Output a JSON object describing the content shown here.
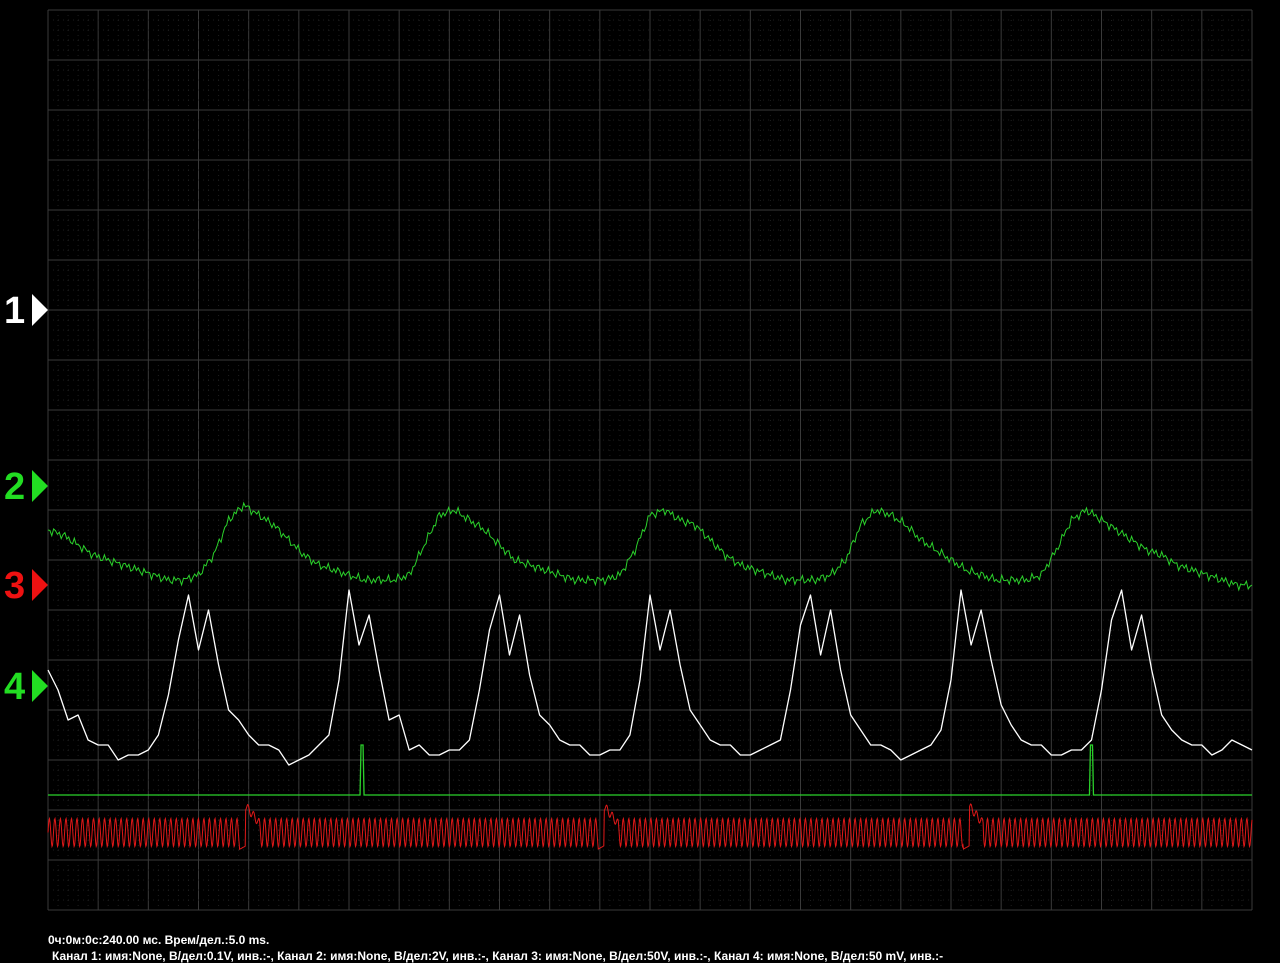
{
  "chart_data": {
    "type": "line",
    "title": "",
    "grid": true,
    "grid_divisions": {
      "horizontal": 24,
      "vertical": 18
    },
    "time_per_division_ms": 5.0,
    "x_unit": "ms",
    "x_range_ms": [
      0,
      120
    ],
    "colors": {
      "background": "#000000",
      "grid": "#3a3a3a",
      "white_trace": "#ffffff",
      "green_trace": "#2bd12b",
      "red_trace": "#e01818",
      "marker_green": "#22dd22",
      "marker_red": "#ee1111"
    },
    "channel_markers": [
      {
        "label": "1",
        "color": "#ffffff"
      },
      {
        "label": "2",
        "color": "#22dd22"
      },
      {
        "label": "3",
        "color": "#ee1111"
      },
      {
        "label": "4",
        "color": "#22dd22"
      }
    ],
    "series": [
      {
        "color": "#2bd12b",
        "x_ms": [
          0,
          1.5,
          3,
          4.5,
          6,
          7.5,
          9,
          10.5,
          12,
          13.5,
          15,
          16.5,
          18,
          19.5,
          21,
          22.5,
          24,
          25.5,
          27,
          28.5,
          30,
          31.5,
          33,
          34.5,
          36,
          37.5,
          39,
          40.5,
          42,
          43.5,
          45,
          46.5,
          48,
          49.5,
          51,
          52.5,
          54,
          55.5,
          57,
          58.5,
          60,
          61.5,
          63,
          64.5,
          66,
          67.5,
          69,
          70.5,
          72,
          73.5,
          75,
          76.5,
          78,
          79.5,
          81,
          82.5,
          84,
          85.5,
          87,
          88.5,
          90,
          91.5,
          93,
          94.5,
          96,
          97.5,
          99,
          100.5,
          102,
          103.5,
          105,
          106.5,
          108,
          109.5,
          111,
          112.5,
          114,
          115.5,
          117,
          118.5,
          120
        ],
        "y_div": [
          7.6,
          7.5,
          7.3,
          7.1,
          7.0,
          6.9,
          6.8,
          6.7,
          6.6,
          6.6,
          6.7,
          7.1,
          7.8,
          8.1,
          7.9,
          7.7,
          7.4,
          7.1,
          6.9,
          6.8,
          6.7,
          6.6,
          6.6,
          6.6,
          6.7,
          7.3,
          7.9,
          8.0,
          7.8,
          7.6,
          7.3,
          7.0,
          6.9,
          6.8,
          6.7,
          6.6,
          6.6,
          6.6,
          6.7,
          7.2,
          7.9,
          8.0,
          7.8,
          7.7,
          7.4,
          7.1,
          6.9,
          6.8,
          6.7,
          6.6,
          6.6,
          6.6,
          6.7,
          7.0,
          7.7,
          8.0,
          7.9,
          7.7,
          7.4,
          7.2,
          7.0,
          6.8,
          6.7,
          6.6,
          6.6,
          6.6,
          6.7,
          7.2,
          7.8,
          8.0,
          7.8,
          7.6,
          7.4,
          7.2,
          7.1,
          6.9,
          6.8,
          6.7,
          6.6,
          6.5,
          6.5
        ]
      },
      {
        "color": "#ffffff",
        "x_ms": [
          0,
          1,
          2,
          3,
          4,
          5,
          6,
          7,
          8,
          9,
          10,
          11,
          12,
          13,
          14,
          15,
          16,
          17,
          18,
          19,
          20,
          21,
          22,
          23,
          24,
          25,
          26,
          27,
          28,
          29,
          30,
          31,
          32,
          33,
          34,
          35,
          36,
          37,
          38,
          39,
          40,
          41,
          42,
          43,
          44,
          45,
          46,
          47,
          48,
          49,
          50,
          51,
          52,
          53,
          54,
          55,
          56,
          57,
          58,
          59,
          60,
          61,
          62,
          63,
          64,
          65,
          66,
          67,
          68,
          69,
          70,
          71,
          72,
          73,
          74,
          75,
          76,
          77,
          78,
          79,
          80,
          81,
          82,
          83,
          84,
          85,
          86,
          87,
          88,
          89,
          90,
          91,
          92,
          93,
          94,
          95,
          96,
          97,
          98,
          99,
          100,
          101,
          102,
          103,
          104,
          105,
          106,
          107,
          108,
          109,
          110,
          111,
          112,
          113,
          114,
          115,
          116,
          117,
          118,
          119,
          120
        ],
        "y_div": [
          4.8,
          4.4,
          3.8,
          3.9,
          3.4,
          3.3,
          3.3,
          3.0,
          3.1,
          3.1,
          3.2,
          3.5,
          4.3,
          5.4,
          6.3,
          5.2,
          6.0,
          4.9,
          4.0,
          3.8,
          3.5,
          3.3,
          3.3,
          3.2,
          2.9,
          3.0,
          3.1,
          3.3,
          3.5,
          4.6,
          6.4,
          5.3,
          5.9,
          4.8,
          3.8,
          3.9,
          3.2,
          3.3,
          3.1,
          3.1,
          3.2,
          3.2,
          3.4,
          4.4,
          5.6,
          6.3,
          5.1,
          5.9,
          4.7,
          3.9,
          3.7,
          3.4,
          3.3,
          3.3,
          3.1,
          3.1,
          3.2,
          3.2,
          3.5,
          4.6,
          6.3,
          5.2,
          6.0,
          4.9,
          4.0,
          3.7,
          3.4,
          3.3,
          3.3,
          3.1,
          3.1,
          3.2,
          3.3,
          3.4,
          4.4,
          5.7,
          6.3,
          5.1,
          6.0,
          4.8,
          3.9,
          3.6,
          3.3,
          3.3,
          3.2,
          3.0,
          3.1,
          3.2,
          3.3,
          3.6,
          4.6,
          6.4,
          5.3,
          6.0,
          5.0,
          4.1,
          3.7,
          3.4,
          3.3,
          3.3,
          3.1,
          3.1,
          3.2,
          3.2,
          3.4,
          4.4,
          5.8,
          6.4,
          5.2,
          5.9,
          4.8,
          3.9,
          3.6,
          3.4,
          3.3,
          3.3,
          3.1,
          3.2,
          3.4,
          3.3,
          3.2
        ]
      },
      {
        "color": "#2bd12b",
        "baseline_div": 2.3,
        "spikes": [
          {
            "x_ms": 31.3,
            "amplitude_div": 1.0
          },
          {
            "x_ms": 104.0,
            "amplitude_div": 1.0
          }
        ]
      },
      {
        "color": "#e01818",
        "center_div": 1.55,
        "amplitude_div": 0.28,
        "cycle_ms": 0.55,
        "glitches": [
          {
            "x_ms": 19.7
          },
          {
            "x_ms": 55.4
          },
          {
            "x_ms": 91.8
          }
        ]
      }
    ]
  },
  "status": {
    "line1": "0ч:0м:0с:240.00 мс. Врем/дел.:5.0 ms.",
    "line2": "Канал 1: имя:None, В/дел:0.1V, инв.:-, Канал 2: имя:None, В/дел:2V, инв.:-, Канал 3: имя:None, В/дел:50V, инв.:-, Канал 4: имя:None, В/дел:50 mV, инв.:-"
  }
}
